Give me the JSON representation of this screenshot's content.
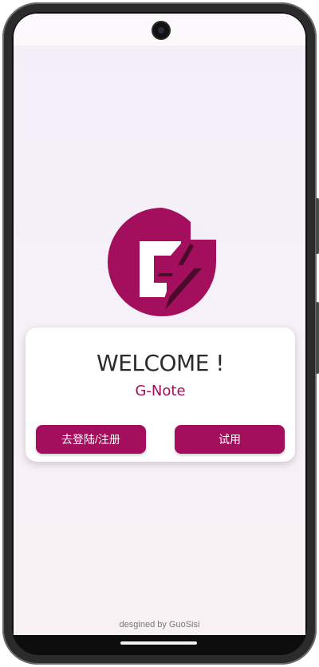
{
  "colors": {
    "accent": "#a30f5d",
    "logo_dark": "#4a0a2a",
    "card_bg": "#ffffff",
    "welcome_text": "#2c2c2c"
  },
  "welcome": {
    "title": "WELCOME !",
    "app_name": "G-Note"
  },
  "buttons": {
    "login_label": "去登陆/注册",
    "trial_label": "试用"
  },
  "footer": {
    "credit": "desgined by GuoSisi"
  },
  "icons": {
    "logo": "g-lightning-logo-icon",
    "camera": "front-camera-icon"
  }
}
